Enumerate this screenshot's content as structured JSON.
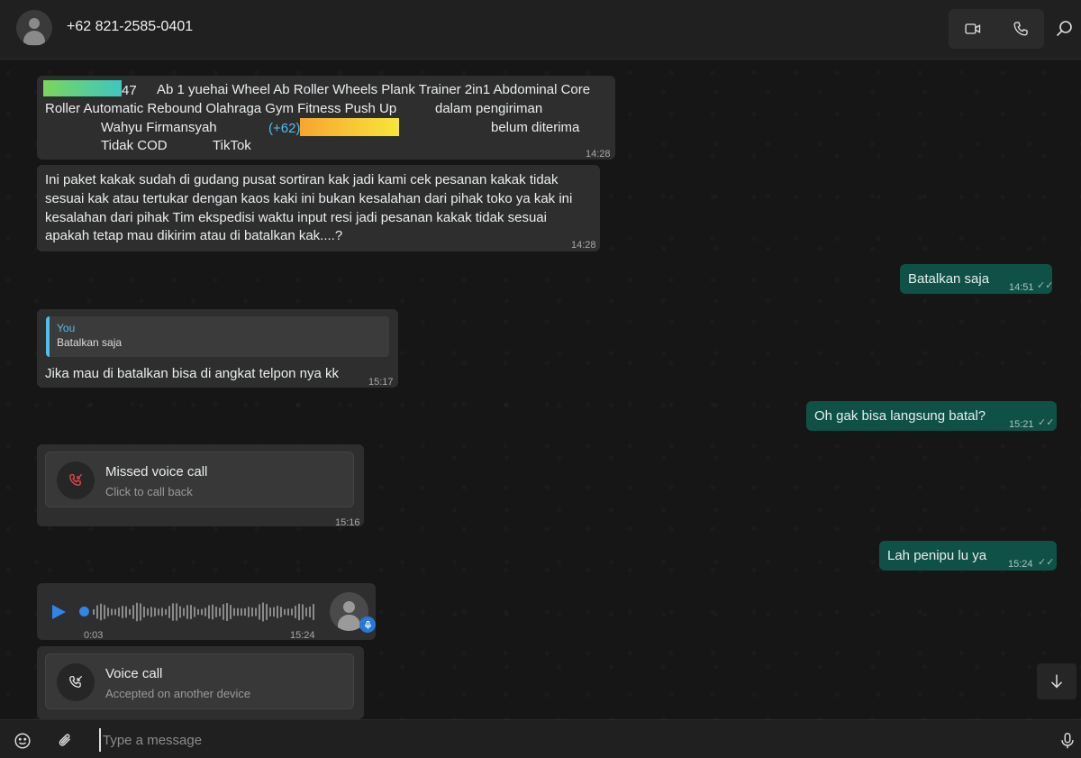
{
  "header": {
    "contact_name": "+62 821-2585-0401",
    "video_call_icon": "video-camera-icon",
    "voice_call_icon": "phone-icon",
    "search_icon": "search-icon"
  },
  "messages": [
    {
      "type": "incoming",
      "line1_num": "47",
      "line1_text": "Ab 1 yuehai Wheel Ab Roller Wheels Plank Trainer 2in1 Abdominal Core",
      "line2_a": "Roller Automatic Rebound Olahraga Gym Fitness Push Up",
      "line2_b": "dalam pengiriman",
      "line3_name": "Wahyu Firmansyah",
      "line3_phone": "(+62)",
      "line3_status": "belum diterima",
      "line4_a": "Tidak COD",
      "line4_b": "TikTok",
      "time": "14:28"
    },
    {
      "type": "incoming",
      "line1": "Ini paket kakak sudah di gudang pusat sortiran kak jadi kami cek pesanan kakak tidak",
      "line2": "sesuai kak atau tertukar dengan kaos kaki ini bukan kesalahan dari pihak toko ya kak ini",
      "line3": "kesalahan dari pihak Tim ekspedisi waktu input resi jadi pesanan kakak tidak sesuai",
      "line4": "apakah tetap mau dikirim atau di batalkan kak....?",
      "time": "14:28"
    },
    {
      "type": "outgoing",
      "text": "Batalkan saja",
      "time": "14:51"
    },
    {
      "type": "incoming-reply",
      "quote_author": "You",
      "quote_text": "Batalkan saja",
      "text": "Jika mau di batalkan bisa di angkat telpon nya kk",
      "time": "15:17"
    },
    {
      "type": "outgoing",
      "text": "Oh gak bisa langsung batal?",
      "time": "15:21"
    },
    {
      "type": "call",
      "title": "Missed voice call",
      "subtitle": "Click to call back",
      "time": "15:16"
    },
    {
      "type": "outgoing",
      "text": "Lah penipu lu ya",
      "time": "15:24"
    },
    {
      "type": "voice-note",
      "elapsed": "0:03",
      "time": "15:24",
      "progress": 0.0
    },
    {
      "type": "call",
      "title": "Voice call",
      "subtitle": "Accepted on another device"
    }
  ],
  "composer": {
    "placeholder": "Type a message",
    "emoji_icon": "emoji-icon",
    "attach_icon": "paperclip-icon",
    "mic_icon": "microphone-icon"
  },
  "colors": {
    "incoming_bubble": "#2e2e2e",
    "outgoing_bubble": "#0f5146",
    "accent_blue": "#53bdeb",
    "missed_call_red": "#e5484d"
  }
}
